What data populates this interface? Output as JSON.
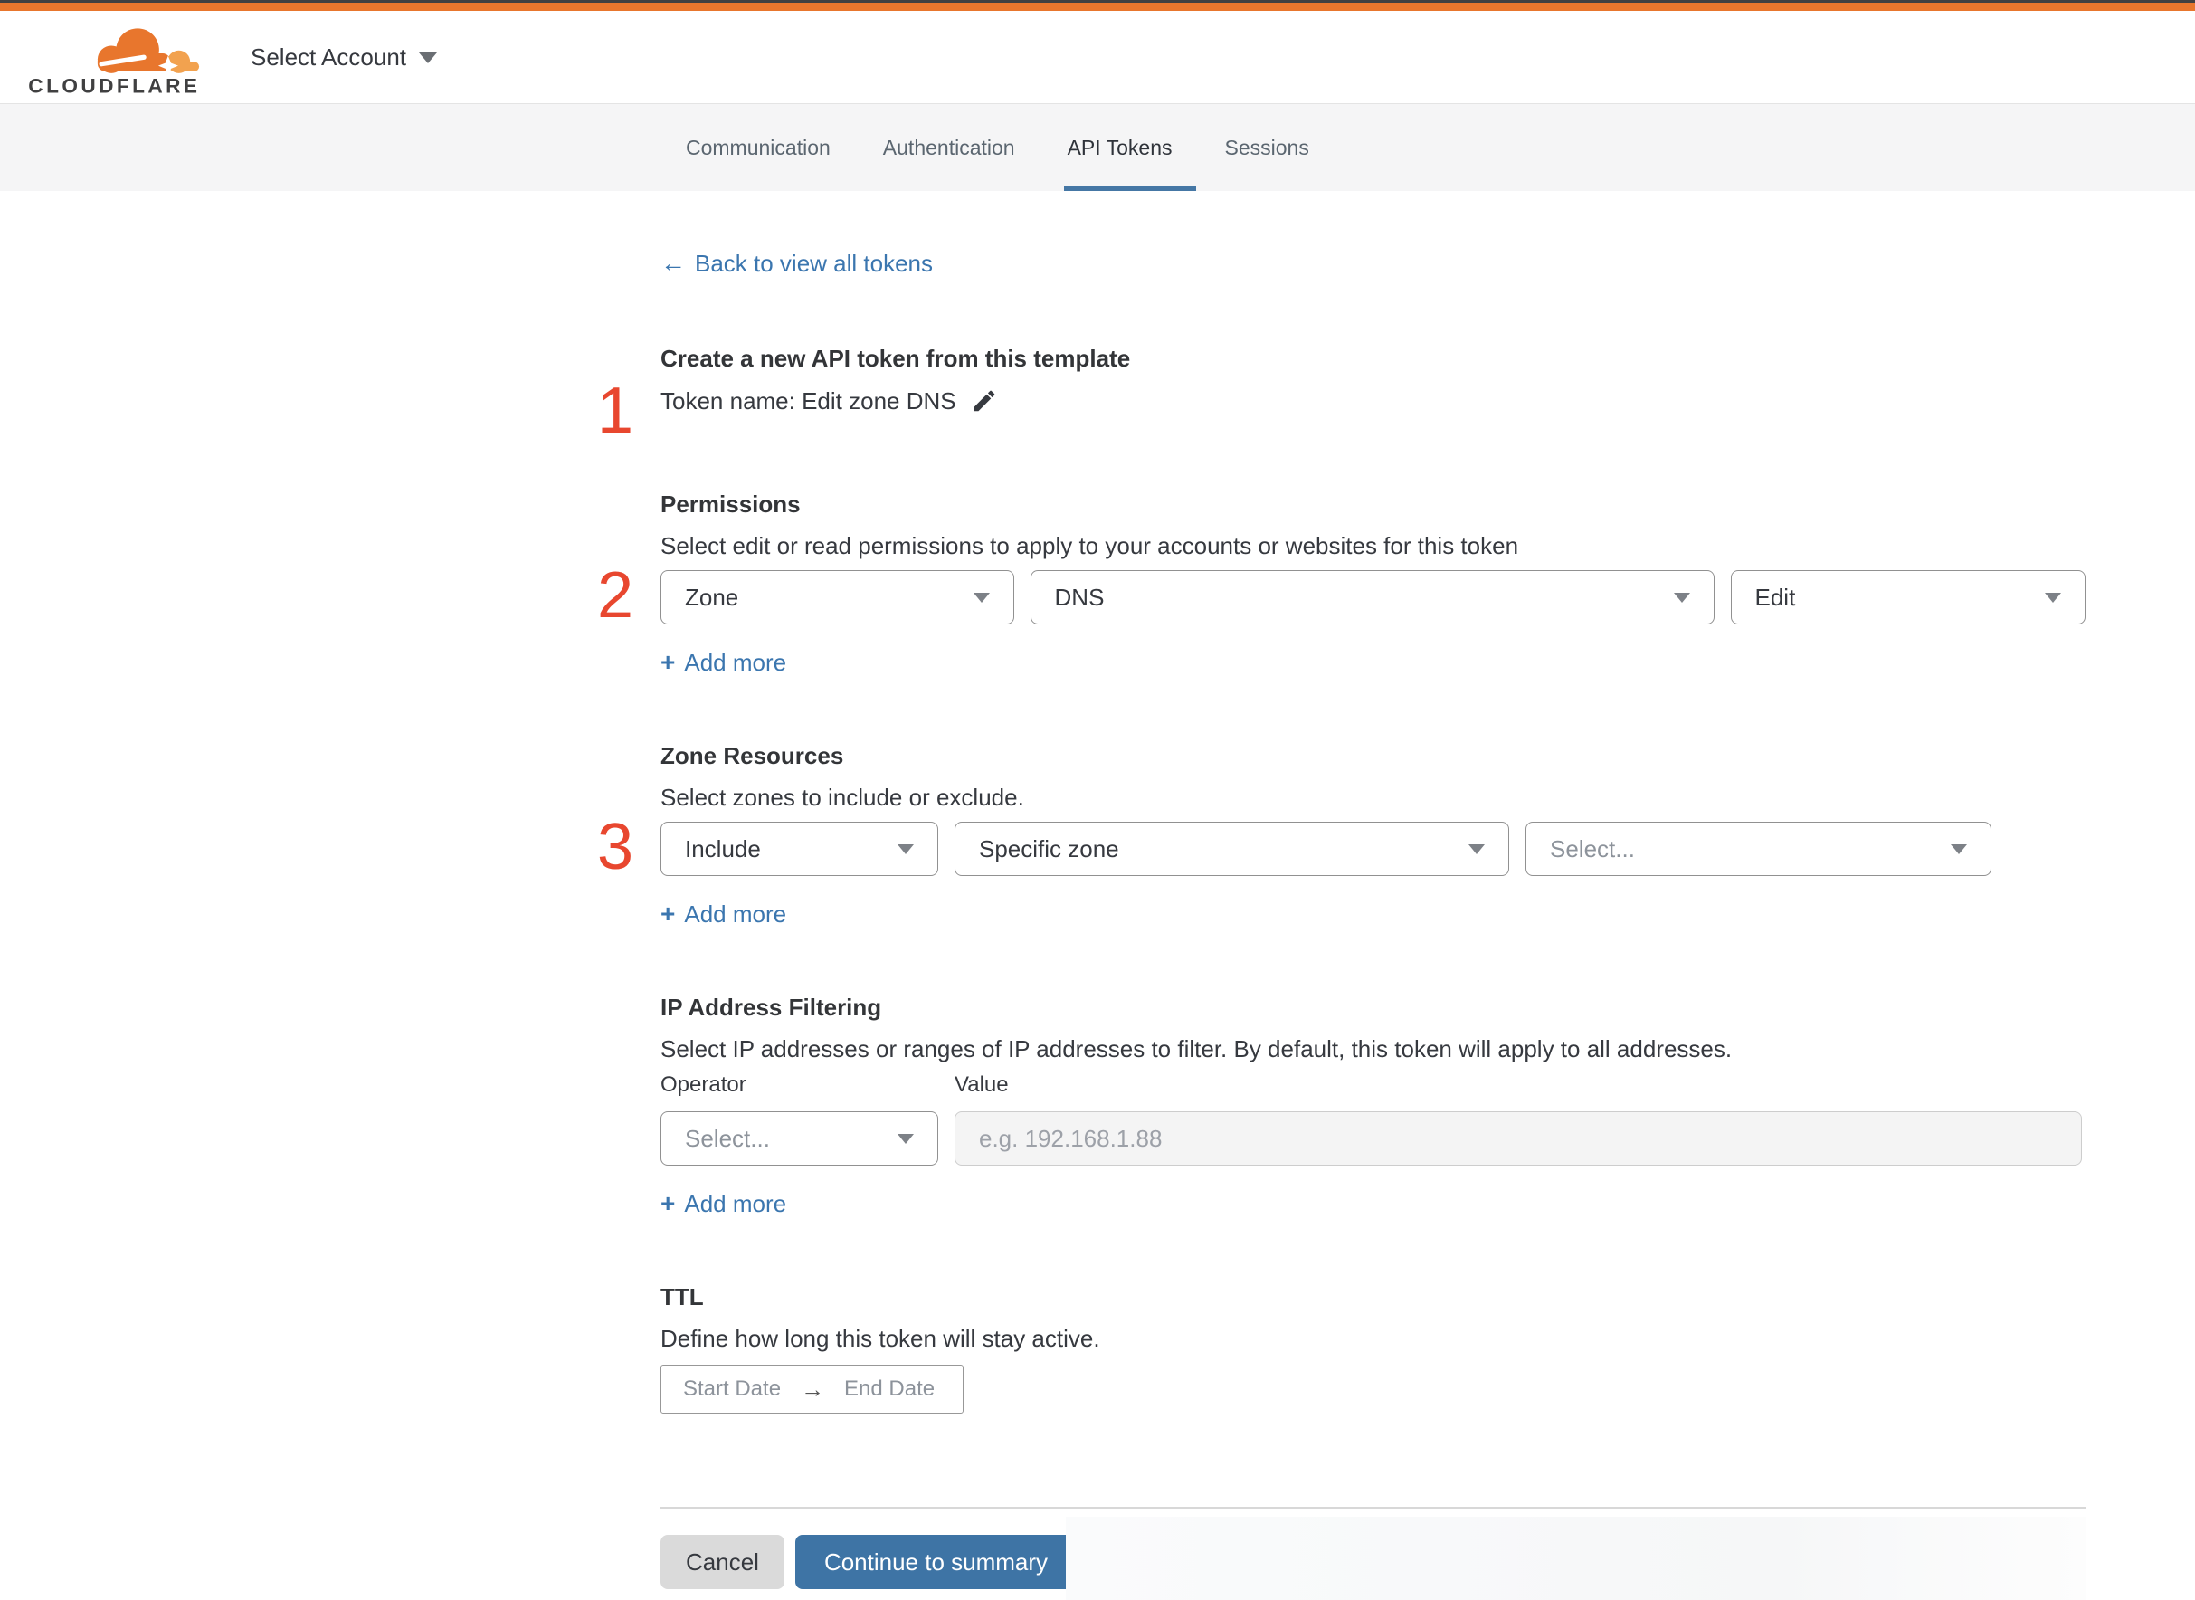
{
  "colors": {
    "accent_orange": "#e8762d",
    "top_line_dark": "#404041",
    "link_blue": "#3b76af",
    "tab_underline_blue": "#4577a5",
    "primary_button_blue": "#3e74a5",
    "step_number_red": "#e8472f",
    "tabbar_background": "#f5f5f6"
  },
  "ui": {
    "back_arrow": "←",
    "range_arrow": "→",
    "plus": "+"
  },
  "header": {
    "logo_text": "CLOUDFLARE",
    "account_selector_label": "Select Account"
  },
  "tabs": {
    "items": [
      {
        "label": "Communication",
        "active": false
      },
      {
        "label": "Authentication",
        "active": false
      },
      {
        "label": "API Tokens",
        "active": true
      },
      {
        "label": "Sessions",
        "active": false
      }
    ]
  },
  "content": {
    "back_link_label": "Back to view all tokens",
    "step1": {
      "number": "1",
      "title": "Create a new API token from this template",
      "token_name_line": "Token name: Edit zone DNS"
    },
    "permissions": {
      "number": "2",
      "title": "Permissions",
      "description": "Select edit or read permissions to apply to your accounts or websites for this token",
      "selects": [
        {
          "value": "Zone"
        },
        {
          "value": "DNS"
        },
        {
          "value": "Edit"
        }
      ],
      "add_more_label": "Add more"
    },
    "zone_resources": {
      "number": "3",
      "title": "Zone Resources",
      "description": "Select zones to include or exclude.",
      "selects": [
        {
          "value": "Include"
        },
        {
          "value": "Specific zone"
        },
        {
          "value": "Select..."
        }
      ],
      "add_more_label": "Add more"
    },
    "ip_filtering": {
      "title": "IP Address Filtering",
      "description": "Select IP addresses or ranges of IP addresses to filter. By default, this token will apply to all addresses.",
      "operator_label": "Operator",
      "value_label": "Value",
      "operator_select_value": "Select...",
      "value_placeholder": "e.g. 192.168.1.88",
      "add_more_label": "Add more"
    },
    "ttl": {
      "title": "TTL",
      "description": "Define how long this token will stay active.",
      "start_date_placeholder": "Start Date",
      "end_date_placeholder": "End Date"
    },
    "footer": {
      "cancel_label": "Cancel",
      "continue_label": "Continue to summary"
    }
  }
}
